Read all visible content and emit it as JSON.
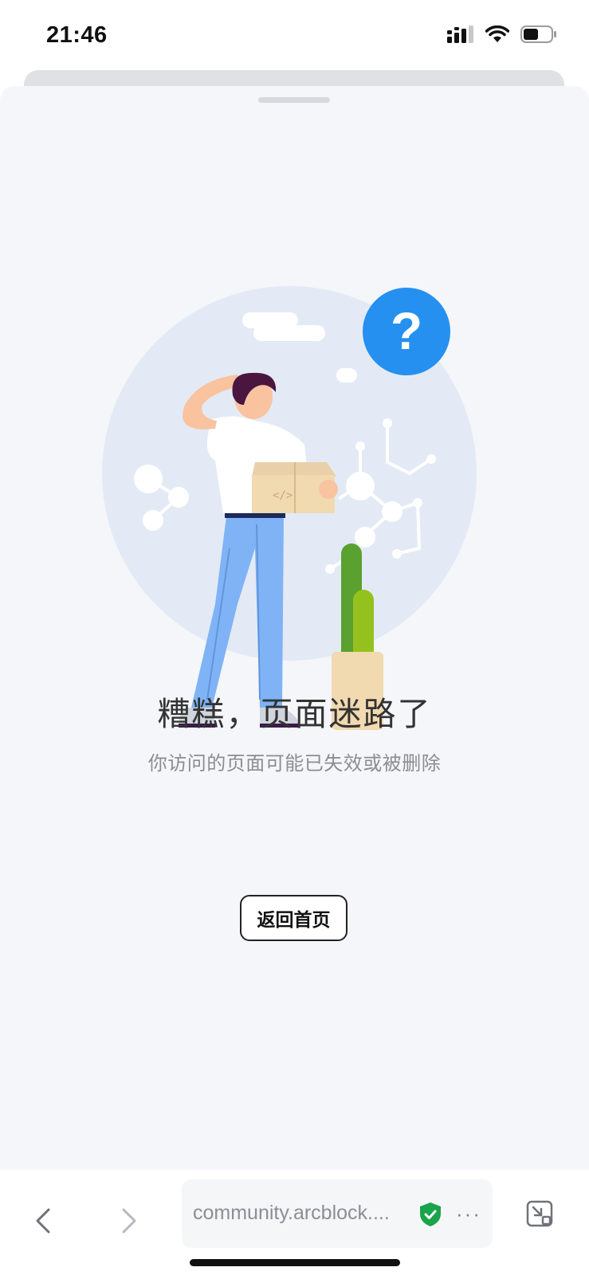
{
  "status_bar": {
    "time": "21:46"
  },
  "content": {
    "title": "糟糕，页面迷路了",
    "subtitle": "你访问的页面可能已失效或被删除",
    "home_button": "返回首页"
  },
  "browser_bar": {
    "url": "community.arcblock....",
    "more": "···"
  },
  "colors": {
    "accent_blue": "#2590f0",
    "secure_green": "#19a34a",
    "sheet_bg": "#f4f6f9"
  },
  "icons": [
    "back-icon",
    "forward-icon",
    "secure-shield-icon",
    "more-icon",
    "pip-icon",
    "signal-icon",
    "wifi-icon",
    "battery-icon"
  ]
}
